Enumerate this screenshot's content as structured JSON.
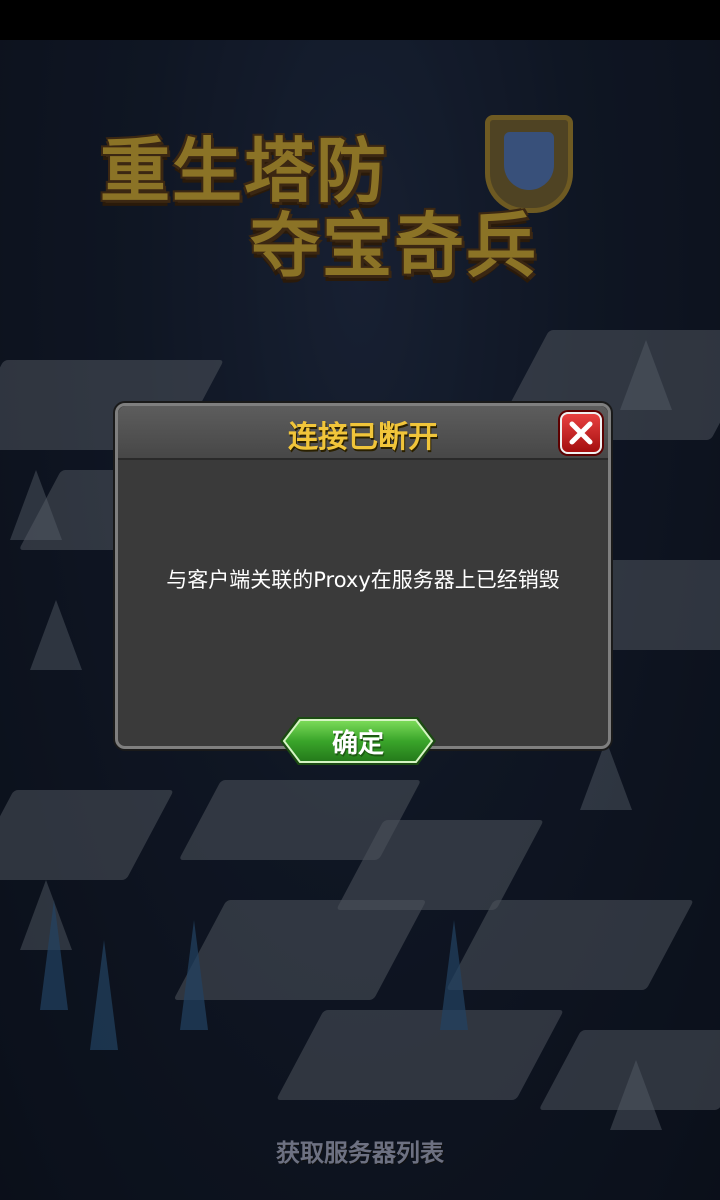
{
  "game": {
    "title_line1": "重生塔防",
    "title_line2": "夺宝奇兵"
  },
  "dialog": {
    "title": "连接已断开",
    "message": "与客户端关联的Proxy在服务器上已经销毁",
    "confirm_label": "确定",
    "close_icon": "close-icon"
  },
  "footer": {
    "status": "获取服务器列表"
  },
  "colors": {
    "dialog_title": "#f1c53a",
    "confirm_button": "#3aa52a",
    "close_button": "#d32121"
  }
}
